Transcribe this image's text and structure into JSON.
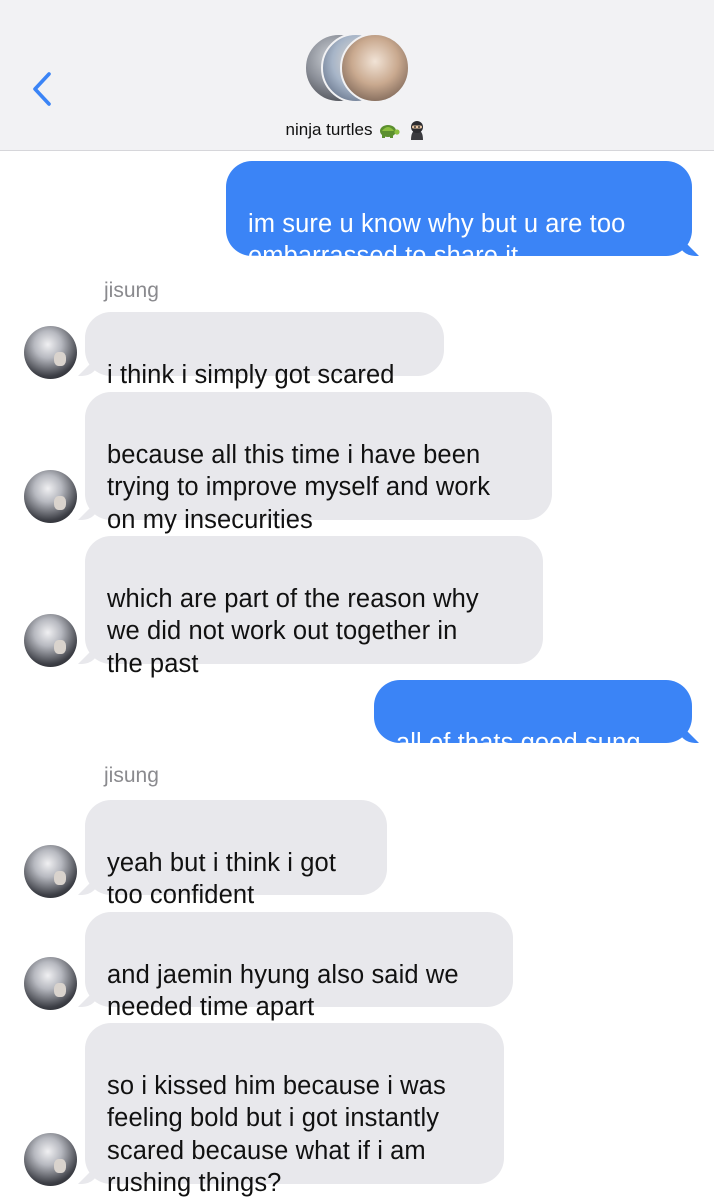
{
  "header": {
    "group_name": "ninja turtles",
    "emojis": [
      "turtle-emoji",
      "ninja-emoji"
    ]
  },
  "messages": [
    {
      "from": "me",
      "text": "im sure u know why but u are too\nembarrassed to share it"
    },
    {
      "sender_label": "jisung"
    },
    {
      "from": "jisung",
      "text": "i think i simply got scared"
    },
    {
      "from": "jisung",
      "text": "because all this time i have been\ntrying to improve myself and work\non my insecurities"
    },
    {
      "from": "jisung",
      "text": "which are part of the reason why\nwe did not work out together in\nthe past"
    },
    {
      "from": "me",
      "text": "all of thats good sung"
    },
    {
      "sender_label": "jisung"
    },
    {
      "from": "jisung",
      "text": "yeah but i think i got\ntoo confident"
    },
    {
      "from": "jisung",
      "text": "and jaemin hyung also said we\nneeded time apart"
    },
    {
      "from": "jisung",
      "text": "so i kissed him because i was\nfeeling bold but i got instantly\nscared because what if i am\nrushing things?"
    }
  ],
  "colors": {
    "sent_bubble": "#3b84f6",
    "received_bubble": "#e8e8ec",
    "back_chevron": "#3b84f6"
  }
}
